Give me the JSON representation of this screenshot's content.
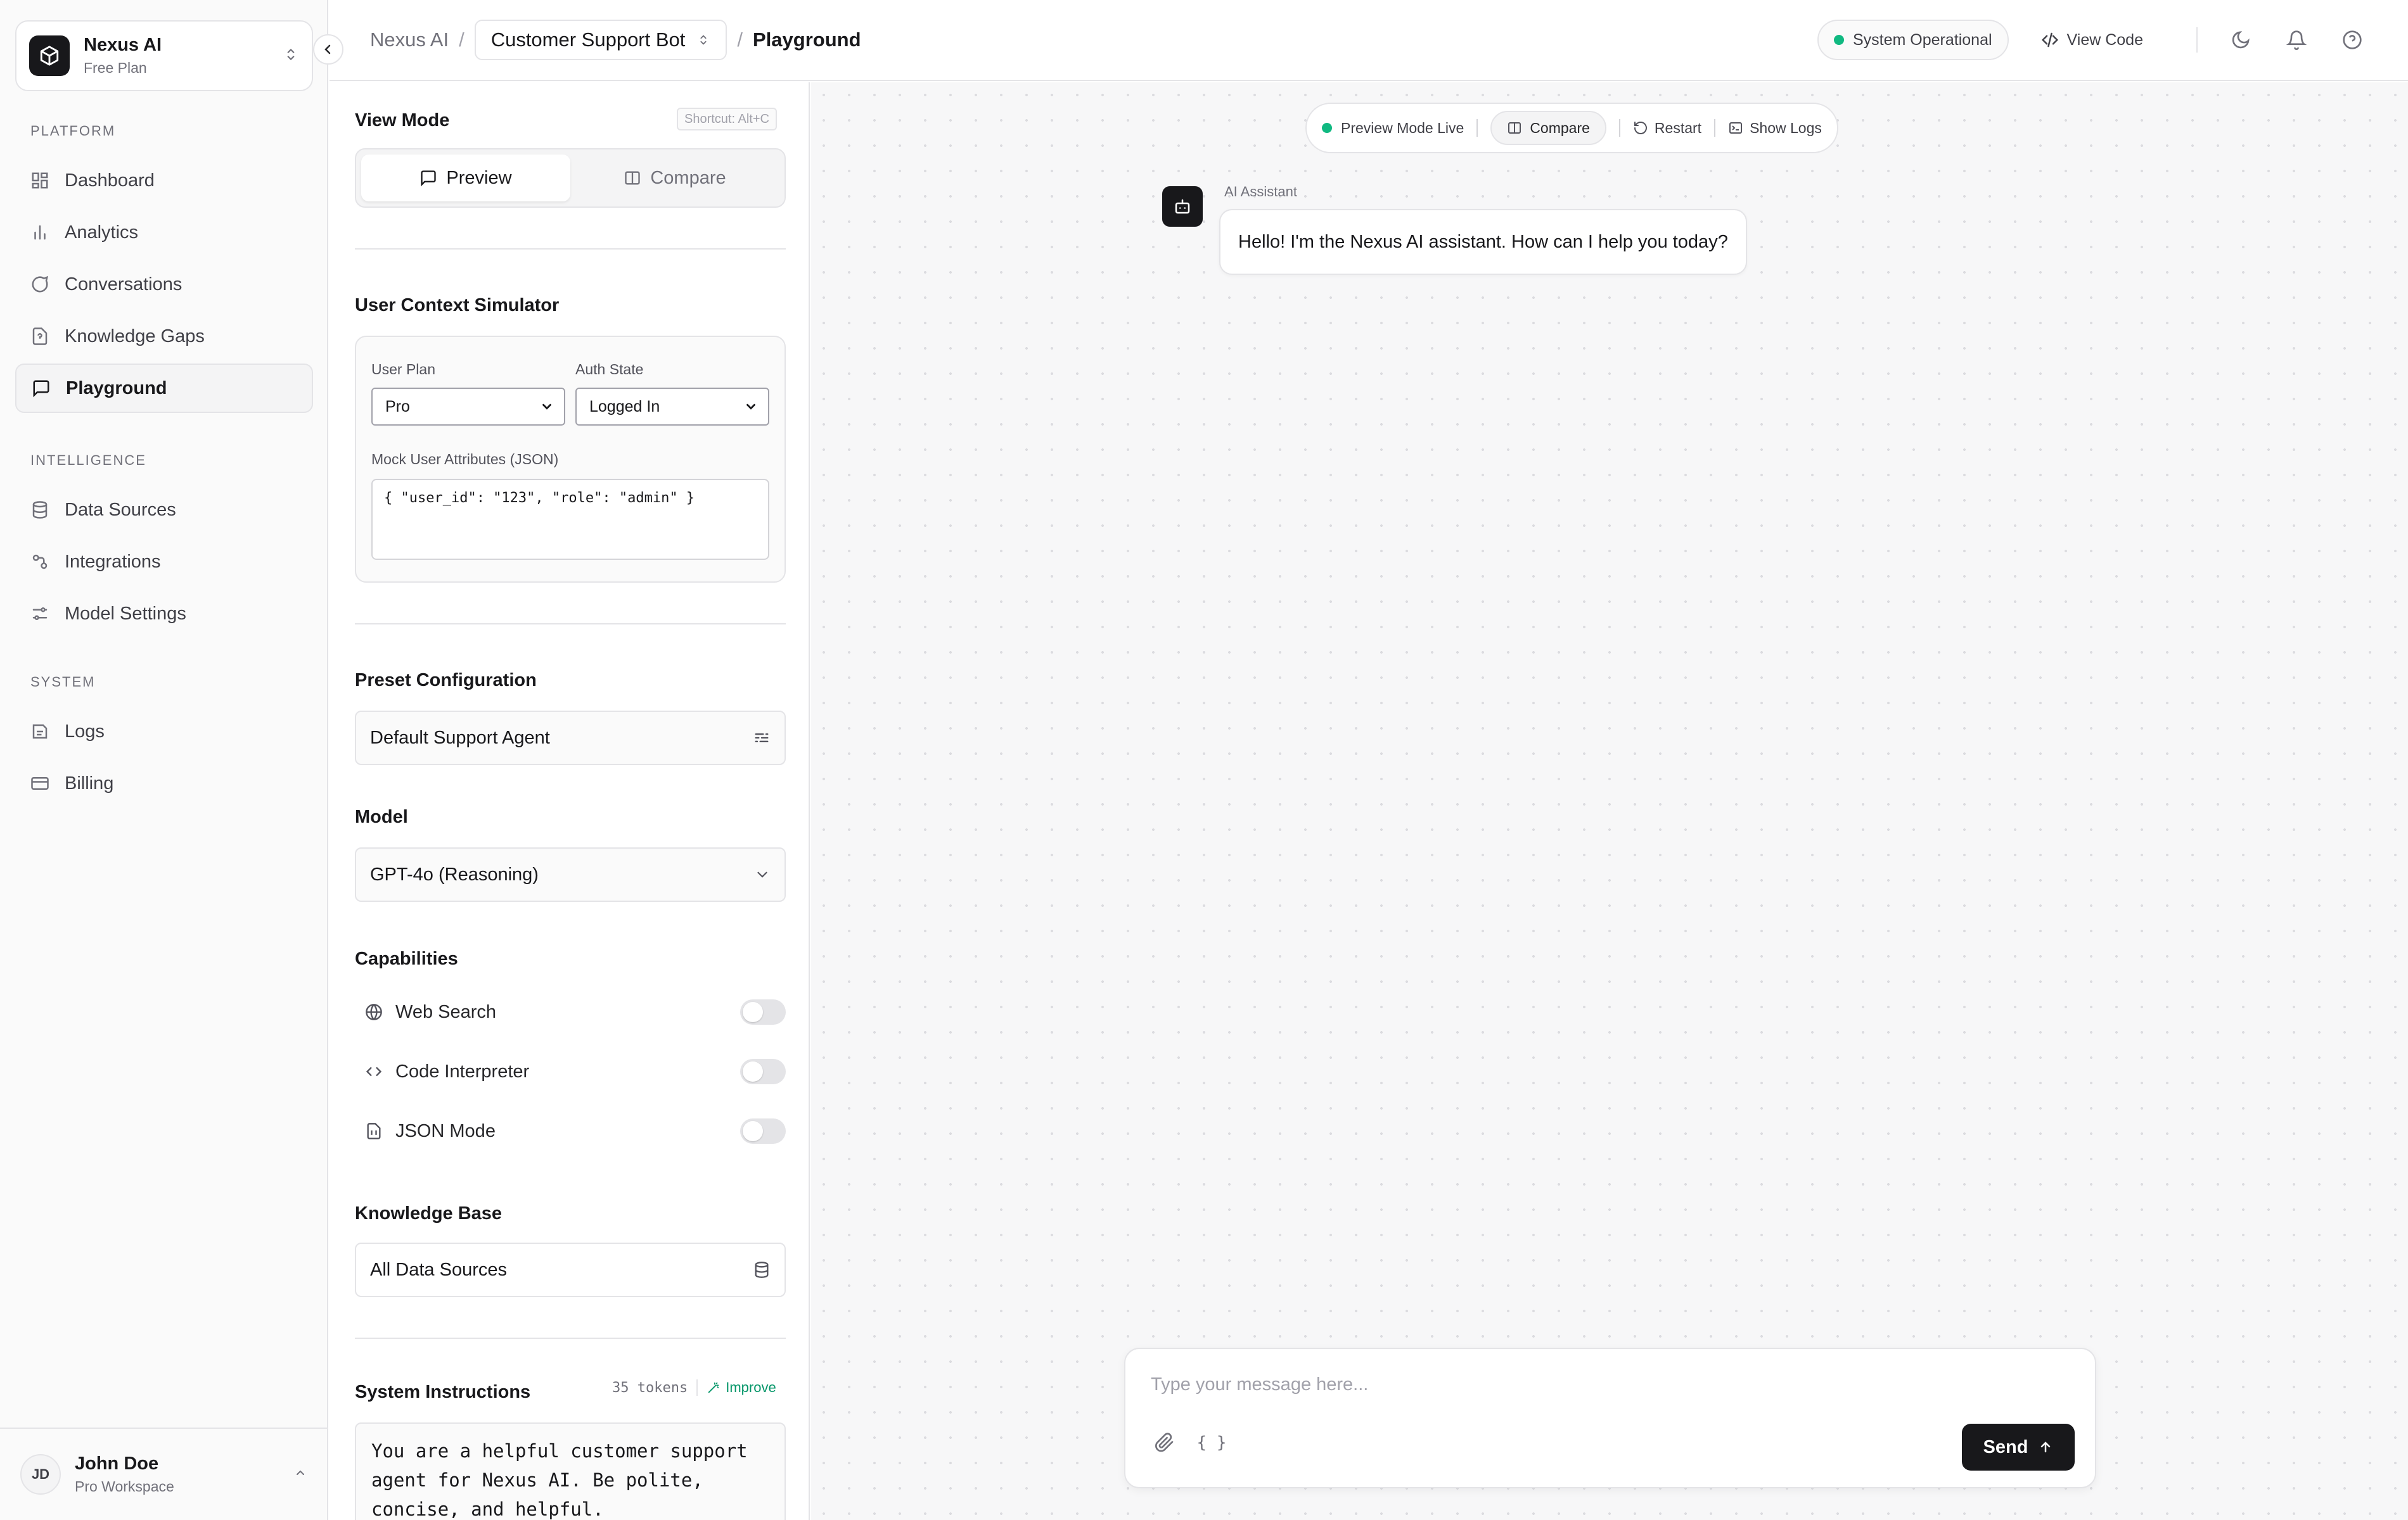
{
  "workspace": {
    "name": "Nexus AI",
    "plan": "Free Plan"
  },
  "sidebar": {
    "sections": [
      {
        "label": "Platform",
        "items": [
          {
            "label": "Dashboard",
            "icon": "dashboard-icon"
          },
          {
            "label": "Analytics",
            "icon": "bar-chart-icon"
          },
          {
            "label": "Conversations",
            "icon": "chat-bubble-icon"
          },
          {
            "label": "Knowledge Gaps",
            "icon": "file-question-icon"
          },
          {
            "label": "Playground",
            "icon": "message-square-icon",
            "active": true
          }
        ]
      },
      {
        "label": "Intelligence",
        "items": [
          {
            "label": "Data Sources",
            "icon": "database-icon"
          },
          {
            "label": "Integrations",
            "icon": "integrations-icon"
          },
          {
            "label": "Model Settings",
            "icon": "sliders-icon"
          }
        ]
      },
      {
        "label": "System",
        "items": [
          {
            "label": "Logs",
            "icon": "logs-icon"
          },
          {
            "label": "Billing",
            "icon": "credit-card-icon"
          }
        ]
      }
    ]
  },
  "user": {
    "initials": "JD",
    "name": "John Doe",
    "workspace": "Pro Workspace"
  },
  "header": {
    "breadcrumb_root": "Nexus AI",
    "bot_select": "Customer Support Bot",
    "current_page": "Playground",
    "status": "System Operational",
    "view_code": "View Code",
    "status_color": "#10b981"
  },
  "config": {
    "view_mode_title": "View Mode",
    "shortcut": "Shortcut: Alt+C",
    "view_modes": [
      "Preview",
      "Compare"
    ],
    "active_view_mode": "Preview",
    "context_title": "User Context Simulator",
    "user_plan_label": "User Plan",
    "user_plan_value": "Pro",
    "auth_state_label": "Auth State",
    "auth_state_value": "Logged In",
    "mock_attrs_label": "Mock User Attributes (JSON)",
    "mock_attrs_value": "{ \"user_id\": \"123\", \"role\": \"admin\" }",
    "preset_title": "Preset Configuration",
    "preset_value": "Default Support Agent",
    "model_title": "Model",
    "model_value": "GPT-4o (Reasoning)",
    "capabilities_title": "Capabilities",
    "capabilities": [
      {
        "label": "Web Search",
        "icon": "globe-icon",
        "enabled": false
      },
      {
        "label": "Code Interpreter",
        "icon": "code-icon",
        "enabled": false
      },
      {
        "label": "JSON Mode",
        "icon": "file-json-icon",
        "enabled": false
      }
    ],
    "kb_title": "Knowledge Base",
    "kb_value": "All Data Sources",
    "sys_title": "System Instructions",
    "tokens": "35 tokens",
    "improve": "Improve",
    "sys_text": "You are a helpful customer support agent for Nexus AI. Be polite, concise, and helpful."
  },
  "preview": {
    "toolbar": {
      "live": "Preview Mode Live",
      "compare": "Compare",
      "restart": "Restart",
      "logs": "Show Logs"
    },
    "messages": [
      {
        "sender": "AI Assistant",
        "text": "Hello! I'm the Nexus AI assistant. How can I help you today?"
      }
    ],
    "composer_placeholder": "Type your message here...",
    "json_icon_label": "{ }",
    "send_label": "Send"
  },
  "accent_color": "#18181b"
}
